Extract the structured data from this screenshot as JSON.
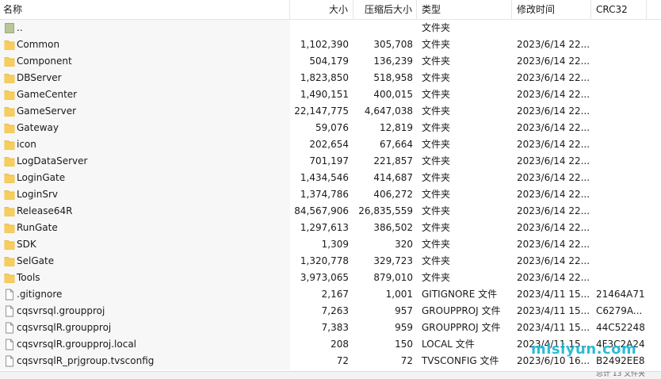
{
  "columns": {
    "name": "名称",
    "size": "大小",
    "packed": "压缩后大小",
    "type": "类型",
    "modified": "修改时间",
    "crc": "CRC32"
  },
  "rows": [
    {
      "name": "..",
      "size": "",
      "packed": "",
      "type": "文件夹",
      "modified": "",
      "crc": "",
      "icon": "parent-folder-icon"
    },
    {
      "name": "Common",
      "size": "1,102,390",
      "packed": "305,708",
      "type": "文件夹",
      "modified": "2023/6/14 22...",
      "crc": "",
      "icon": "folder-icon"
    },
    {
      "name": "Component",
      "size": "504,179",
      "packed": "136,239",
      "type": "文件夹",
      "modified": "2023/6/14 22...",
      "crc": "",
      "icon": "folder-icon"
    },
    {
      "name": "DBServer",
      "size": "1,823,850",
      "packed": "518,958",
      "type": "文件夹",
      "modified": "2023/6/14 22...",
      "crc": "",
      "icon": "folder-icon"
    },
    {
      "name": "GameCenter",
      "size": "1,490,151",
      "packed": "400,015",
      "type": "文件夹",
      "modified": "2023/6/14 22...",
      "crc": "",
      "icon": "folder-icon"
    },
    {
      "name": "GameServer",
      "size": "22,147,775",
      "packed": "4,647,038",
      "type": "文件夹",
      "modified": "2023/6/14 22...",
      "crc": "",
      "icon": "folder-icon"
    },
    {
      "name": "Gateway",
      "size": "59,076",
      "packed": "12,819",
      "type": "文件夹",
      "modified": "2023/6/14 22...",
      "crc": "",
      "icon": "folder-icon"
    },
    {
      "name": "icon",
      "size": "202,654",
      "packed": "67,664",
      "type": "文件夹",
      "modified": "2023/6/14 22...",
      "crc": "",
      "icon": "folder-icon"
    },
    {
      "name": "LogDataServer",
      "size": "701,197",
      "packed": "221,857",
      "type": "文件夹",
      "modified": "2023/6/14 22...",
      "crc": "",
      "icon": "folder-icon"
    },
    {
      "name": "LoginGate",
      "size": "1,434,546",
      "packed": "414,687",
      "type": "文件夹",
      "modified": "2023/6/14 22...",
      "crc": "",
      "icon": "folder-icon"
    },
    {
      "name": "LoginSrv",
      "size": "1,374,786",
      "packed": "406,272",
      "type": "文件夹",
      "modified": "2023/6/14 22...",
      "crc": "",
      "icon": "folder-icon"
    },
    {
      "name": "Release64R",
      "size": "84,567,906",
      "packed": "26,835,559",
      "type": "文件夹",
      "modified": "2023/6/14 22...",
      "crc": "",
      "icon": "folder-icon"
    },
    {
      "name": "RunGate",
      "size": "1,297,613",
      "packed": "386,502",
      "type": "文件夹",
      "modified": "2023/6/14 22...",
      "crc": "",
      "icon": "folder-icon"
    },
    {
      "name": "SDK",
      "size": "1,309",
      "packed": "320",
      "type": "文件夹",
      "modified": "2023/6/14 22...",
      "crc": "",
      "icon": "folder-icon"
    },
    {
      "name": "SelGate",
      "size": "1,320,778",
      "packed": "329,723",
      "type": "文件夹",
      "modified": "2023/6/14 22...",
      "crc": "",
      "icon": "folder-icon"
    },
    {
      "name": "Tools",
      "size": "3,973,065",
      "packed": "879,010",
      "type": "文件夹",
      "modified": "2023/6/14 22...",
      "crc": "",
      "icon": "folder-icon"
    },
    {
      "name": ".gitignore",
      "size": "2,167",
      "packed": "1,001",
      "type": "GITIGNORE 文件",
      "modified": "2023/4/11 15...",
      "crc": "21464A71",
      "icon": "file-icon"
    },
    {
      "name": "cqsvrsql.groupproj",
      "size": "7,263",
      "packed": "957",
      "type": "GROUPPROJ 文件",
      "modified": "2023/4/11 15...",
      "crc": "C6279A...",
      "icon": "file-icon"
    },
    {
      "name": "cqsvrsqlR.groupproj",
      "size": "7,383",
      "packed": "959",
      "type": "GROUPPROJ 文件",
      "modified": "2023/4/11 15...",
      "crc": "44C52248",
      "icon": "file-icon"
    },
    {
      "name": "cqsvrsqlR.groupproj.local",
      "size": "208",
      "packed": "150",
      "type": "LOCAL 文件",
      "modified": "2023/4/11 15...",
      "crc": "4F3C2A24",
      "icon": "file-icon"
    },
    {
      "name": "cqsvrsqlR_prjgroup.tvsconfig",
      "size": "72",
      "packed": "72",
      "type": "TVSCONFIG 文件",
      "modified": "2023/6/10 16...",
      "crc": "B2492EE8",
      "icon": "file-icon"
    }
  ],
  "watermark": "mlsiyun.com",
  "statusbar": {
    "text": "总计 13 文件夹"
  },
  "colors": {
    "folder": "#f7cd5c",
    "folder_dark": "#e5b43a",
    "name_column_bg": "#f7f7f7",
    "watermark": "#19b7d4"
  }
}
